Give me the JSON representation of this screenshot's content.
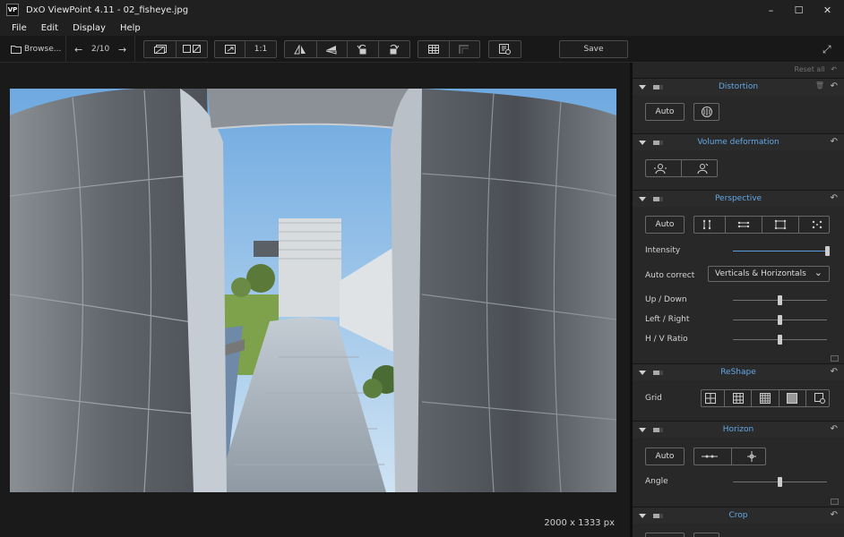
{
  "window": {
    "app_icon_text": "VP",
    "title": "DxO ViewPoint 4.11 - 02_fisheye.jpg",
    "minimize": "–",
    "maximize": "☐",
    "close": "✕"
  },
  "menu": [
    "File",
    "Edit",
    "Display",
    "Help"
  ],
  "toolbar": {
    "browse_icon": "folder-icon",
    "browse": "Browse...",
    "prev": "←",
    "counter": "2/10",
    "next": "→",
    "fit_label": "1:1",
    "save": "Save",
    "fullscreen": "⤢"
  },
  "viewer": {
    "dimensions": "2000 x 1333 px"
  },
  "panel": {
    "reset_all": "Reset all",
    "undo_glyph": "↶",
    "trash_glyph": "🗑",
    "sections": {
      "distortion": {
        "title": "Distortion",
        "auto": "Auto"
      },
      "volume": {
        "title": "Volume deformation"
      },
      "perspective": {
        "title": "Perspective",
        "auto": "Auto",
        "intensity_label": "Intensity",
        "intensity": 1.0,
        "auto_correct_label": "Auto correct",
        "auto_correct_value": "Verticals & Horizontals",
        "chevron": "⌄",
        "updown_label": "Up / Down",
        "updown": 0.5,
        "leftright_label": "Left / Right",
        "leftright": 0.5,
        "hv_label": "H / V Ratio",
        "hv": 0.5
      },
      "reshape": {
        "title": "ReShape",
        "grid_label": "Grid"
      },
      "horizon": {
        "title": "Horizon",
        "auto": "Auto",
        "angle_label": "Angle",
        "angle": 0.5
      },
      "crop": {
        "title": "Crop"
      }
    }
  },
  "colors": {
    "accent": "#62a8e6",
    "sky": "#7fb3df",
    "wall": "#6f747a"
  }
}
